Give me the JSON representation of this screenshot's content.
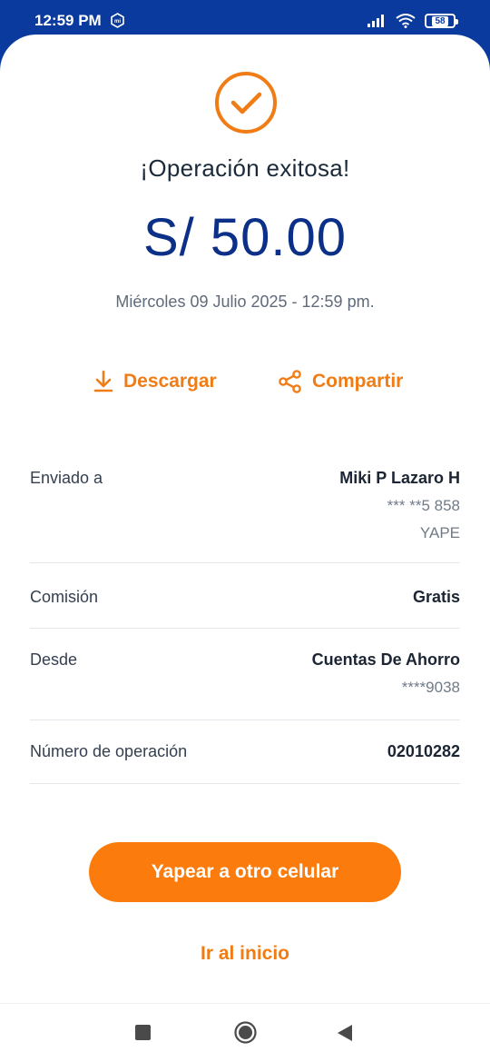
{
  "status_bar": {
    "time": "12:59 PM",
    "battery": "58",
    "icons": [
      "mi-icon",
      "signal-icon",
      "wifi-icon",
      "battery-icon"
    ]
  },
  "receipt": {
    "title": "¡Operación exitosa!",
    "amount": "S/ 50.00",
    "datetime": "Miércoles 09 Julio 2025 - 12:59 pm."
  },
  "actions": {
    "download_label": "Descargar",
    "share_label": "Compartir"
  },
  "details": {
    "sent_to": {
      "label": "Enviado a",
      "name": "Miki P Lazaro H",
      "phone": "*** **5 858",
      "channel": "YAPE"
    },
    "commission": {
      "label": "Comisión",
      "value": "Gratis"
    },
    "from": {
      "label": "Desde",
      "account": "Cuentas De Ahorro",
      "number": "****9038"
    },
    "operation": {
      "label": "Número de operación",
      "value": "02010282"
    }
  },
  "buttons": {
    "primary_label": "Yapear a otro celular",
    "home_label": "Ir al inicio"
  },
  "colors": {
    "header_blue": "#0a3a9e",
    "amount_blue": "#0c2f87",
    "accent_orange": "#fb7b0d"
  }
}
